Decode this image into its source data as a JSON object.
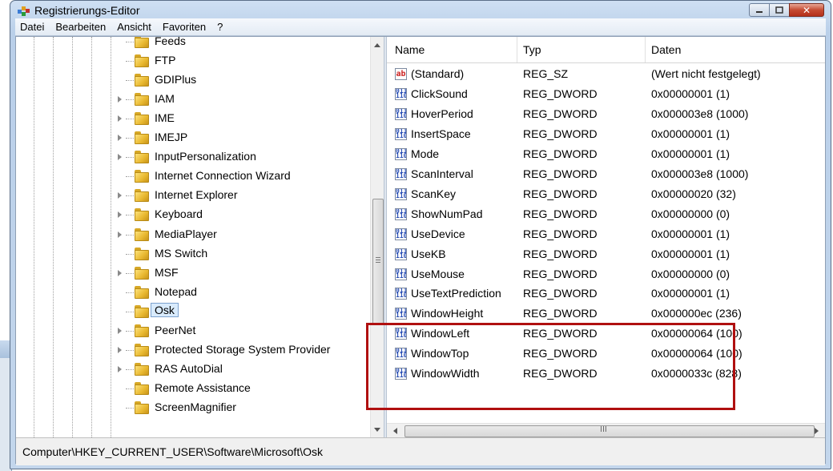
{
  "window": {
    "title": "Registrierungs-Editor",
    "close_glyph": "✕"
  },
  "menu": [
    "Datei",
    "Bearbeiten",
    "Ansicht",
    "Favoriten",
    "?"
  ],
  "tree": [
    {
      "label": "Feeds",
      "expandable": false
    },
    {
      "label": "FTP",
      "expandable": false
    },
    {
      "label": "GDIPlus",
      "expandable": false
    },
    {
      "label": "IAM",
      "expandable": true
    },
    {
      "label": "IME",
      "expandable": true
    },
    {
      "label": "IMEJP",
      "expandable": true
    },
    {
      "label": "InputPersonalization",
      "expandable": true
    },
    {
      "label": "Internet Connection Wizard",
      "expandable": false
    },
    {
      "label": "Internet Explorer",
      "expandable": true
    },
    {
      "label": "Keyboard",
      "expandable": true
    },
    {
      "label": "MediaPlayer",
      "expandable": true
    },
    {
      "label": "MS Switch",
      "expandable": false
    },
    {
      "label": "MSF",
      "expandable": true
    },
    {
      "label": "Notepad",
      "expandable": false
    },
    {
      "label": "Osk",
      "expandable": false,
      "selected": true
    },
    {
      "label": "PeerNet",
      "expandable": true
    },
    {
      "label": "Protected Storage System Provider",
      "expandable": true
    },
    {
      "label": "RAS AutoDial",
      "expandable": true
    },
    {
      "label": "Remote Assistance",
      "expandable": false
    },
    {
      "label": "ScreenMagnifier",
      "expandable": false
    }
  ],
  "list": {
    "columns": {
      "name": "Name",
      "type": "Typ",
      "data": "Daten"
    },
    "rows": [
      {
        "icon": "string-value-icon",
        "glyph": "ab",
        "name": "(Standard)",
        "type": "REG_SZ",
        "data": "(Wert nicht festgelegt)"
      },
      {
        "icon": "binary-value-icon",
        "glyph": "011\n110",
        "name": "ClickSound",
        "type": "REG_DWORD",
        "data": "0x00000001 (1)"
      },
      {
        "icon": "binary-value-icon",
        "glyph": "011\n110",
        "name": "HoverPeriod",
        "type": "REG_DWORD",
        "data": "0x000003e8 (1000)"
      },
      {
        "icon": "binary-value-icon",
        "glyph": "011\n110",
        "name": "InsertSpace",
        "type": "REG_DWORD",
        "data": "0x00000001 (1)"
      },
      {
        "icon": "binary-value-icon",
        "glyph": "011\n110",
        "name": "Mode",
        "type": "REG_DWORD",
        "data": "0x00000001 (1)"
      },
      {
        "icon": "binary-value-icon",
        "glyph": "011\n110",
        "name": "ScanInterval",
        "type": "REG_DWORD",
        "data": "0x000003e8 (1000)"
      },
      {
        "icon": "binary-value-icon",
        "glyph": "011\n110",
        "name": "ScanKey",
        "type": "REG_DWORD",
        "data": "0x00000020 (32)"
      },
      {
        "icon": "binary-value-icon",
        "glyph": "011\n110",
        "name": "ShowNumPad",
        "type": "REG_DWORD",
        "data": "0x00000000 (0)"
      },
      {
        "icon": "binary-value-icon",
        "glyph": "011\n110",
        "name": "UseDevice",
        "type": "REG_DWORD",
        "data": "0x00000001 (1)"
      },
      {
        "icon": "binary-value-icon",
        "glyph": "011\n110",
        "name": "UseKB",
        "type": "REG_DWORD",
        "data": "0x00000001 (1)"
      },
      {
        "icon": "binary-value-icon",
        "glyph": "011\n110",
        "name": "UseMouse",
        "type": "REG_DWORD",
        "data": "0x00000000 (0)"
      },
      {
        "icon": "binary-value-icon",
        "glyph": "011\n110",
        "name": "UseTextPrediction",
        "type": "REG_DWORD",
        "data": "0x00000001 (1)"
      },
      {
        "icon": "binary-value-icon",
        "glyph": "011\n110",
        "name": "WindowHeight",
        "type": "REG_DWORD",
        "data": "0x000000ec (236)"
      },
      {
        "icon": "binary-value-icon",
        "glyph": "011\n110",
        "name": "WindowLeft",
        "type": "REG_DWORD",
        "data": "0x00000064 (100)"
      },
      {
        "icon": "binary-value-icon",
        "glyph": "011\n110",
        "name": "WindowTop",
        "type": "REG_DWORD",
        "data": "0x00000064 (100)"
      },
      {
        "icon": "binary-value-icon",
        "glyph": "011\n110",
        "name": "WindowWidth",
        "type": "REG_DWORD",
        "data": "0x0000033c (828)"
      }
    ]
  },
  "hscroll_grip": "III",
  "statusbar": {
    "path": "Computer\\HKEY_CURRENT_USER\\Software\\Microsoft\\Osk"
  },
  "colors": {
    "highlight": "#b01010",
    "selection": "#d9ebfc"
  }
}
